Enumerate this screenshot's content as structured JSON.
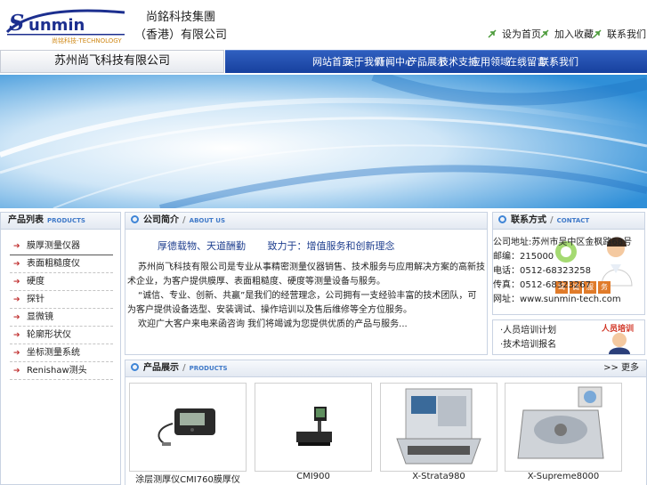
{
  "header": {
    "group_name_line1": "尚銘科技集團",
    "group_name_line2": "（香港）有限公司",
    "logo_text": "SUNMIN",
    "logo_subtext": "尚铭科技-TECHNOLOGY",
    "top_links": [
      "设为首页",
      "加入收藏",
      "联系我们"
    ]
  },
  "nav": {
    "company": "苏州尚飞科技有限公司",
    "items": [
      "网站首页",
      "关于我们",
      "新闻中心",
      "产品展示",
      "技术支持",
      "应用领域",
      "在线留言",
      "联系我们"
    ]
  },
  "products_panel": {
    "title": "产品列表",
    "title_en": "PRODUCTS",
    "items": [
      "膜厚测量仪器",
      "表面粗糙度仪",
      "硬度",
      "探针",
      "显微镜",
      "轮廓形状仪",
      "坐标测量系统",
      "Renishaw测头"
    ]
  },
  "about_panel": {
    "title": "公司简介",
    "title_en": "ABOUT US",
    "slogan": "厚德载物、天道酬勤       致力于：增值服务和创新理念",
    "para1": "苏州尚飞科技有限公司是专业从事精密测量仪器销售、技术服务与应用解决方案的高新技术企业，为客户提供膜厚、表面粗糙度、硬度等测量设备与服务。",
    "para2": "“诚信、专业、创新、共赢”是我们的经营理念，公司拥有一支经验丰富的技术团队，可为客户提供设备选型、安装调试、操作培训以及售后维修等全方位服务。",
    "para3": "欢迎广大客户来电来函咨询 我们将竭诚为您提供优质的产品与服务..."
  },
  "contact_panel": {
    "title": "联系方式",
    "title_en": "CONTACT",
    "lines": [
      "公司地址:苏州市吴中区金枫路68号",
      "邮编：215000",
      "电话：0512-68323258",
      "传真：0512-68323267",
      "网址：www.sunmin-tech.com"
    ],
    "badge_chars": [
      "竭",
      "诚",
      "服",
      "务"
    ]
  },
  "training_panel": {
    "links": [
      "·人员培训计划",
      "·技术培训报名"
    ],
    "badge": "人员培训"
  },
  "showcase_panel": {
    "title": "产品展示",
    "title_en": "PRODUCTS",
    "more": ">> 更多",
    "products": [
      "涂层测厚仪CMI760膜厚仪",
      "CMI900",
      "X-Strata980",
      "X-Supreme8000"
    ]
  },
  "colors": {
    "nav_blue": "#1f4aa8",
    "panel_border": "#c9d3e2",
    "accent_blue": "#3f79c8",
    "arrow_red": "#c03030"
  }
}
